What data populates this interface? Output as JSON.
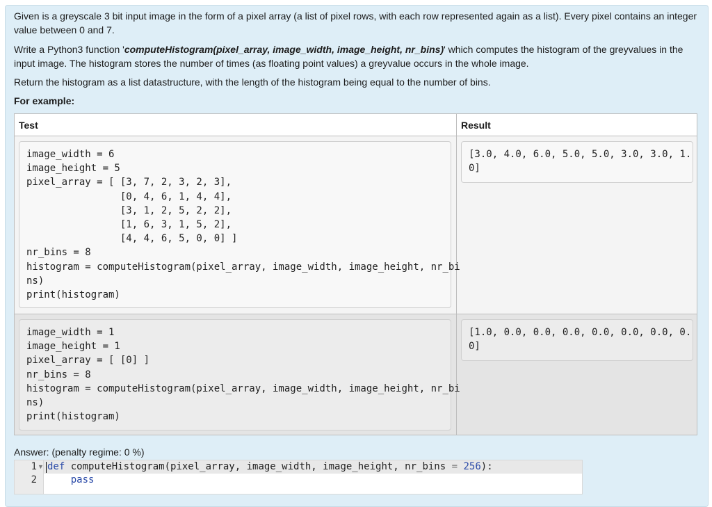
{
  "question": {
    "intro": "Given is a greyscale 3 bit input image in the form of a pixel array (a list of pixel rows, with each row represented again as a list). Every pixel contains an integer value between 0 and 7.",
    "task_prefix": "Write a Python3 function '",
    "task_function": "computeHistogram(pixel_array, image_width, image_height, nr_bins)",
    "task_suffix": "' which computes the histogram of the greyvalues in the input image. The histogram stores the number of times (as floating point values) a greyvalue occurs in the whole image.",
    "return_text": "Return the histogram as a list datastructure, with the length of the histogram being equal to the number of bins.",
    "example_heading": "For example:"
  },
  "table": {
    "headers": {
      "test": "Test",
      "result": "Result"
    },
    "rows": [
      {
        "test_code": "image_width = 6\nimage_height = 5\npixel_array = [ [3, 7, 2, 3, 2, 3],\n                [0, 4, 6, 1, 4, 4],\n                [3, 1, 2, 5, 2, 2],\n                [1, 6, 3, 1, 5, 2],\n                [4, 4, 6, 5, 0, 0] ]\nnr_bins = 8\nhistogram = computeHistogram(pixel_array, image_width, image_height, nr_bi\nns)\nprint(histogram)",
        "result": "[3.0, 4.0, 6.0, 5.0, 5.0, 3.0, 3.0, 1.\n0]"
      },
      {
        "test_code": "image_width = 1\nimage_height = 1\npixel_array = [ [0] ]\nnr_bins = 8\nhistogram = computeHistogram(pixel_array, image_width, image_height, nr_bi\nns)\nprint(histogram)",
        "result": "[1.0, 0.0, 0.0, 0.0, 0.0, 0.0, 0.0, 0.\n0]"
      }
    ]
  },
  "answer": {
    "label": "Answer:  (penalty regime: 0 %)",
    "line_numbers": [
      "1",
      "2"
    ],
    "fold_marker": "▼",
    "code": {
      "kw_def": "def",
      "signature": " computeHistogram(pixel_array, image_width, image_height, nr_bins ",
      "eq": "=",
      "default": "256",
      "tail": "):",
      "line2": "    pass"
    }
  }
}
